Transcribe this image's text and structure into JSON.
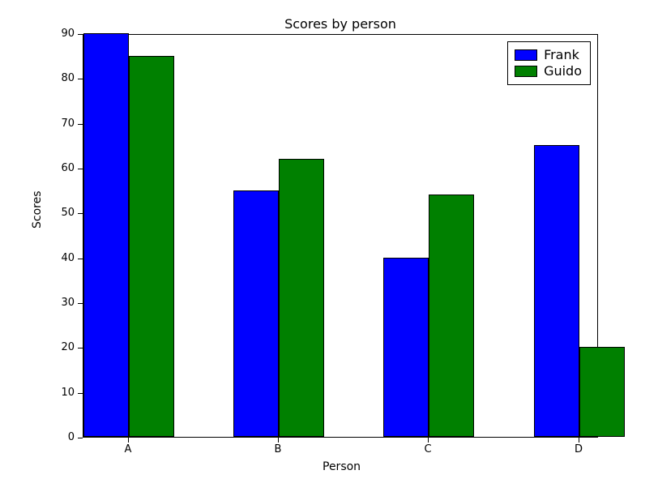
{
  "chart_data": {
    "type": "bar",
    "title": "Scores by person",
    "xlabel": "Person",
    "ylabel": "Scores",
    "categories": [
      "A",
      "B",
      "C",
      "D"
    ],
    "series": [
      {
        "name": "Frank",
        "color": "#0000ff",
        "values": [
          90,
          55,
          40,
          65
        ]
      },
      {
        "name": "Guido",
        "color": "#008000",
        "values": [
          85,
          62,
          54,
          20
        ]
      }
    ],
    "ylim": [
      0,
      90
    ],
    "yticks": [
      0,
      10,
      20,
      30,
      40,
      50,
      60,
      70,
      80,
      90
    ],
    "y_tick_labels": [
      "0",
      "10",
      "20",
      "30",
      "40",
      "50",
      "60",
      "70",
      "80",
      "90"
    ],
    "x_tick_labels": [
      "A",
      "B",
      "C",
      "D"
    ]
  },
  "legend": {
    "items": [
      {
        "label": "Frank"
      },
      {
        "label": "Guido"
      }
    ]
  }
}
